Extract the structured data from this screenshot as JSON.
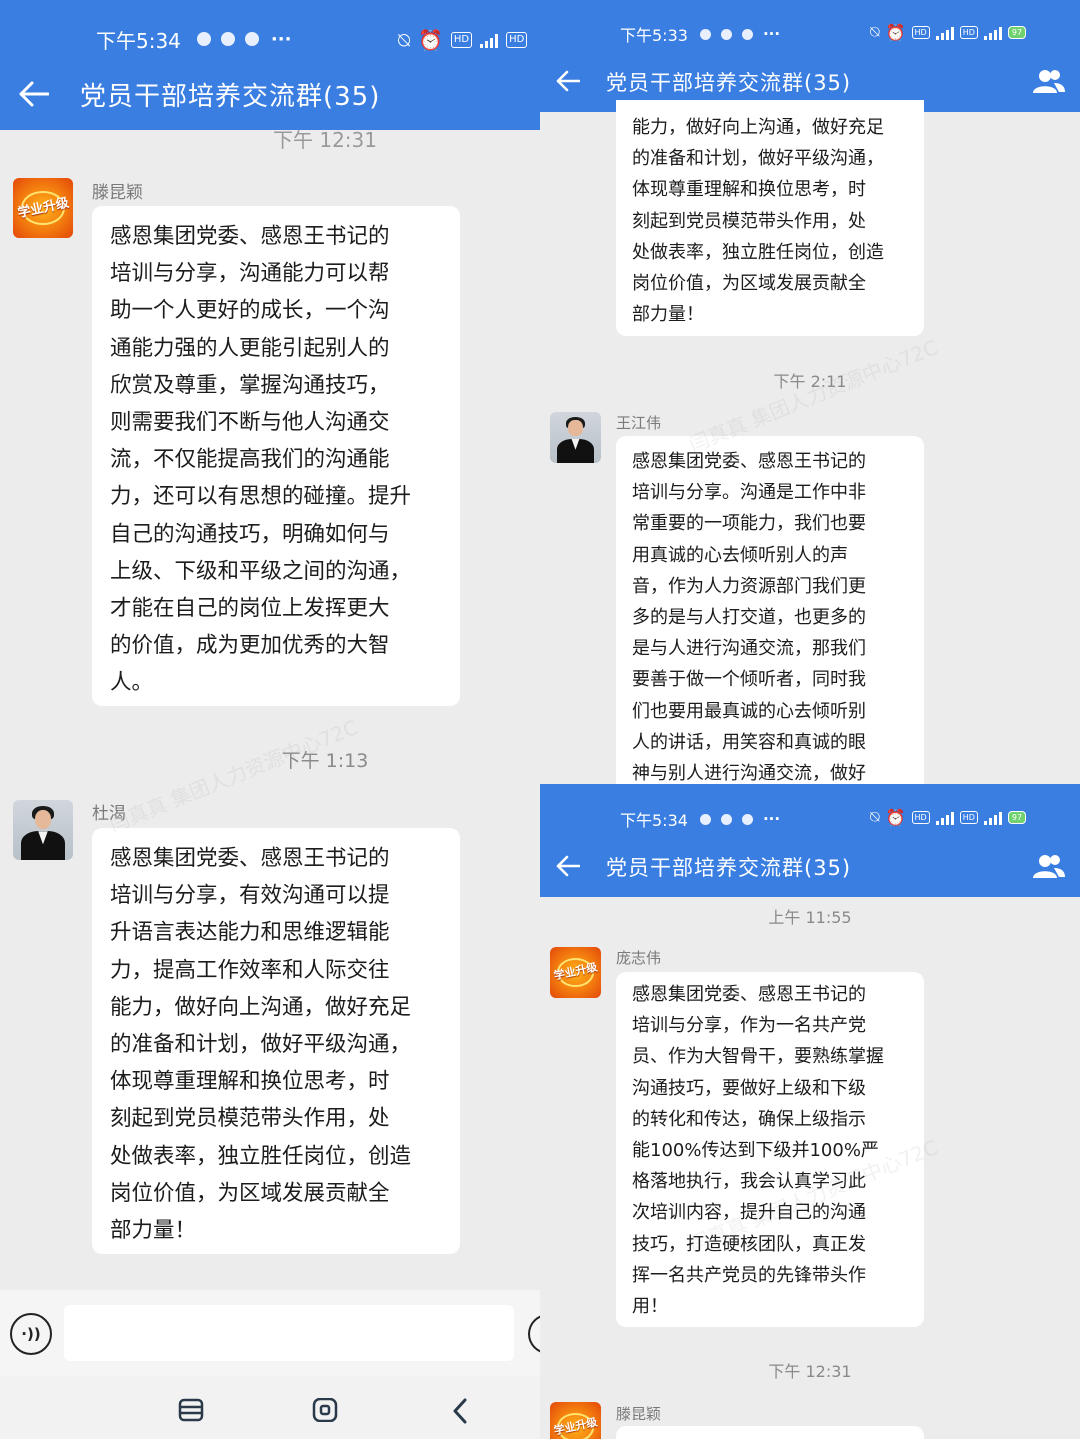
{
  "colors": {
    "header_blue": "#3a7ee2",
    "bg_gray": "#ececec",
    "bubble_white": "#ffffff"
  },
  "panel_left": {
    "status": {
      "time": "下午5:34"
    },
    "title": "党员干部培养交流群(35)",
    "partial_timestamp": "下午 12:31",
    "messages": [
      {
        "sender": "滕昆颖",
        "avatar": "orange-logo-avatar",
        "text": "感恩集团党委、感恩王书记的\n培训与分享，沟通能力可以帮\n助一个人更好的成长，一个沟\n通能力强的人更能引起别人的\n欣赏及尊重，掌握沟通技巧，\n则需要我们不断与他人沟通交\n流，不仅能提高我们的沟通能\n力，还可以有思想的碰撞。提升\n自己的沟通技巧，明确如何与\n上级、下级和平级之间的沟通，\n才能在自己的岗位上发挥更大\n的价值，成为更加优秀的大智\n人。"
      },
      {
        "timestamp": "下午 1:13"
      },
      {
        "sender": "杜渴",
        "avatar": "photo-avatar",
        "text": "感恩集团党委、感恩王书记的\n培训与分享，有效沟通可以提\n升语言表达能力和思维逻辑能\n力，提高工作效率和人际交往\n能力，做好向上沟通，做好充足\n的准备和计划，做好平级沟通，\n体现尊重理解和换位思考，时\n刻起到党员模范带头作用，处\n处做表率，独立胜任岗位，创造\n岗位价值，为区域发展贡献全\n部力量！"
      }
    ]
  },
  "panel_right_top": {
    "status": {
      "time": "下午5:33"
    },
    "title": "党员干部培养交流群(35)",
    "cont_text": "能力，做好向上沟通，做好充足\n的准备和计划，做好平级沟通，\n体现尊重理解和换位思考，时\n刻起到党员模范带头作用，处\n处做表率，独立胜任岗位，创造\n岗位价值，为区域发展贡献全\n部力量！",
    "timestamp": "下午 2:11",
    "sender": "王江伟",
    "text": "感恩集团党委、感恩王书记的\n培训与分享。沟通是工作中非\n常重要的一项能力，我们也要\n用真诚的心去倾听别人的声\n音，作为人力资源部门我们更\n多的是与人打交道，也更多的\n是与人进行沟通交流，那我们\n要善于做一个倾听者，同时我\n们也要用最真诚的心去倾听别\n人的讲话，用笑容和真诚的眼\n神与别人进行沟通交流，做好"
  },
  "panel_right_bottom": {
    "status": {
      "time": "下午5:34"
    },
    "title": "党员干部培养交流群(35)",
    "timestamp1": "上午 11:55",
    "sender": "庞志伟",
    "text": "感恩集团党委、感恩王书记的\n培训与分享，作为一名共产党\n员、作为大智骨干，要熟练掌握\n沟通技巧，要做好上级和下级\n的转化和传达，确保上级指示\n能100%传达到下级并100%严\n格落地执行，我会认真学习此\n次培训内容，提升自己的沟通\n技巧，打造硬核团队，真正发\n挥一名共产党员的先锋带头作\n用！",
    "timestamp2": "下午 12:31",
    "sender2": "滕昆颖"
  },
  "watermark": "闫真真 集团人力资源中心72C",
  "avatar_logo_text": "学业升级"
}
